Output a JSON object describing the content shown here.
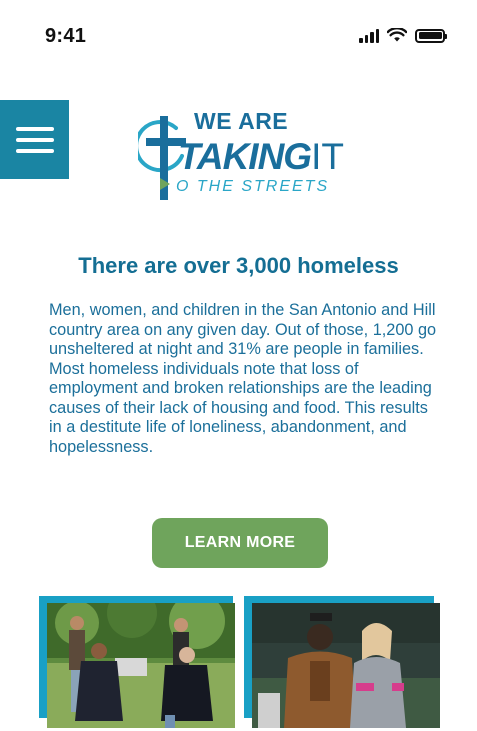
{
  "status_bar": {
    "time": "9:41"
  },
  "menu": {
    "icon": "hamburger-menu-icon"
  },
  "logo": {
    "line1": "WE ARE",
    "line2": "TAKING",
    "line2_suffix": "IT",
    "line3": "O THE STREETS",
    "colors": {
      "navy": "#1a6e9c",
      "teal": "#2aa6c7",
      "green": "#6fa45c"
    }
  },
  "content": {
    "headline": "There are over 3,000 homeless",
    "body": "Men, women, and children in the San Antonio and Hill country area on any given day. Out of those, 1,200 go unsheltered at night and 31% are people in families. Most homeless individuals note that loss of employment and broken relationships are the leading causes of their lack of housing and food. This results in a destitute life of loneliness, abandonment, and hopelessness.",
    "cta_label": "LEARN MORE"
  },
  "colors": {
    "accent": "#1a85a3",
    "button": "#6fa45c",
    "text": "#1b6f9a"
  }
}
